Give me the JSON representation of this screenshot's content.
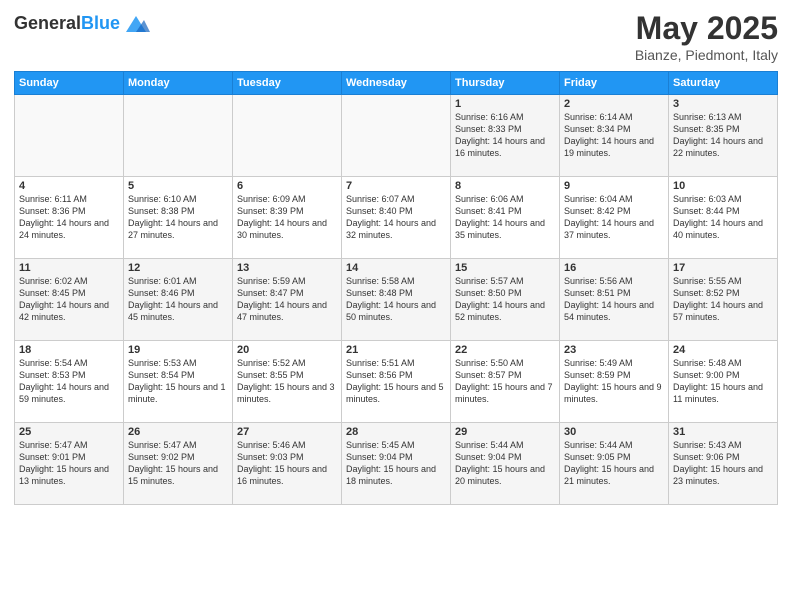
{
  "header": {
    "logo_general": "General",
    "logo_blue": "Blue",
    "month": "May 2025",
    "location": "Bianze, Piedmont, Italy"
  },
  "weekdays": [
    "Sunday",
    "Monday",
    "Tuesday",
    "Wednesday",
    "Thursday",
    "Friday",
    "Saturday"
  ],
  "weeks": [
    [
      {
        "day": "",
        "sunrise": "",
        "sunset": "",
        "daylight": ""
      },
      {
        "day": "",
        "sunrise": "",
        "sunset": "",
        "daylight": ""
      },
      {
        "day": "",
        "sunrise": "",
        "sunset": "",
        "daylight": ""
      },
      {
        "day": "",
        "sunrise": "",
        "sunset": "",
        "daylight": ""
      },
      {
        "day": "1",
        "sunrise": "Sunrise: 6:16 AM",
        "sunset": "Sunset: 8:33 PM",
        "daylight": "Daylight: 14 hours and 16 minutes."
      },
      {
        "day": "2",
        "sunrise": "Sunrise: 6:14 AM",
        "sunset": "Sunset: 8:34 PM",
        "daylight": "Daylight: 14 hours and 19 minutes."
      },
      {
        "day": "3",
        "sunrise": "Sunrise: 6:13 AM",
        "sunset": "Sunset: 8:35 PM",
        "daylight": "Daylight: 14 hours and 22 minutes."
      }
    ],
    [
      {
        "day": "4",
        "sunrise": "Sunrise: 6:11 AM",
        "sunset": "Sunset: 8:36 PM",
        "daylight": "Daylight: 14 hours and 24 minutes."
      },
      {
        "day": "5",
        "sunrise": "Sunrise: 6:10 AM",
        "sunset": "Sunset: 8:38 PM",
        "daylight": "Daylight: 14 hours and 27 minutes."
      },
      {
        "day": "6",
        "sunrise": "Sunrise: 6:09 AM",
        "sunset": "Sunset: 8:39 PM",
        "daylight": "Daylight: 14 hours and 30 minutes."
      },
      {
        "day": "7",
        "sunrise": "Sunrise: 6:07 AM",
        "sunset": "Sunset: 8:40 PM",
        "daylight": "Daylight: 14 hours and 32 minutes."
      },
      {
        "day": "8",
        "sunrise": "Sunrise: 6:06 AM",
        "sunset": "Sunset: 8:41 PM",
        "daylight": "Daylight: 14 hours and 35 minutes."
      },
      {
        "day": "9",
        "sunrise": "Sunrise: 6:04 AM",
        "sunset": "Sunset: 8:42 PM",
        "daylight": "Daylight: 14 hours and 37 minutes."
      },
      {
        "day": "10",
        "sunrise": "Sunrise: 6:03 AM",
        "sunset": "Sunset: 8:44 PM",
        "daylight": "Daylight: 14 hours and 40 minutes."
      }
    ],
    [
      {
        "day": "11",
        "sunrise": "Sunrise: 6:02 AM",
        "sunset": "Sunset: 8:45 PM",
        "daylight": "Daylight: 14 hours and 42 minutes."
      },
      {
        "day": "12",
        "sunrise": "Sunrise: 6:01 AM",
        "sunset": "Sunset: 8:46 PM",
        "daylight": "Daylight: 14 hours and 45 minutes."
      },
      {
        "day": "13",
        "sunrise": "Sunrise: 5:59 AM",
        "sunset": "Sunset: 8:47 PM",
        "daylight": "Daylight: 14 hours and 47 minutes."
      },
      {
        "day": "14",
        "sunrise": "Sunrise: 5:58 AM",
        "sunset": "Sunset: 8:48 PM",
        "daylight": "Daylight: 14 hours and 50 minutes."
      },
      {
        "day": "15",
        "sunrise": "Sunrise: 5:57 AM",
        "sunset": "Sunset: 8:50 PM",
        "daylight": "Daylight: 14 hours and 52 minutes."
      },
      {
        "day": "16",
        "sunrise": "Sunrise: 5:56 AM",
        "sunset": "Sunset: 8:51 PM",
        "daylight": "Daylight: 14 hours and 54 minutes."
      },
      {
        "day": "17",
        "sunrise": "Sunrise: 5:55 AM",
        "sunset": "Sunset: 8:52 PM",
        "daylight": "Daylight: 14 hours and 57 minutes."
      }
    ],
    [
      {
        "day": "18",
        "sunrise": "Sunrise: 5:54 AM",
        "sunset": "Sunset: 8:53 PM",
        "daylight": "Daylight: 14 hours and 59 minutes."
      },
      {
        "day": "19",
        "sunrise": "Sunrise: 5:53 AM",
        "sunset": "Sunset: 8:54 PM",
        "daylight": "Daylight: 15 hours and 1 minute."
      },
      {
        "day": "20",
        "sunrise": "Sunrise: 5:52 AM",
        "sunset": "Sunset: 8:55 PM",
        "daylight": "Daylight: 15 hours and 3 minutes."
      },
      {
        "day": "21",
        "sunrise": "Sunrise: 5:51 AM",
        "sunset": "Sunset: 8:56 PM",
        "daylight": "Daylight: 15 hours and 5 minutes."
      },
      {
        "day": "22",
        "sunrise": "Sunrise: 5:50 AM",
        "sunset": "Sunset: 8:57 PM",
        "daylight": "Daylight: 15 hours and 7 minutes."
      },
      {
        "day": "23",
        "sunrise": "Sunrise: 5:49 AM",
        "sunset": "Sunset: 8:59 PM",
        "daylight": "Daylight: 15 hours and 9 minutes."
      },
      {
        "day": "24",
        "sunrise": "Sunrise: 5:48 AM",
        "sunset": "Sunset: 9:00 PM",
        "daylight": "Daylight: 15 hours and 11 minutes."
      }
    ],
    [
      {
        "day": "25",
        "sunrise": "Sunrise: 5:47 AM",
        "sunset": "Sunset: 9:01 PM",
        "daylight": "Daylight: 15 hours and 13 minutes."
      },
      {
        "day": "26",
        "sunrise": "Sunrise: 5:47 AM",
        "sunset": "Sunset: 9:02 PM",
        "daylight": "Daylight: 15 hours and 15 minutes."
      },
      {
        "day": "27",
        "sunrise": "Sunrise: 5:46 AM",
        "sunset": "Sunset: 9:03 PM",
        "daylight": "Daylight: 15 hours and 16 minutes."
      },
      {
        "day": "28",
        "sunrise": "Sunrise: 5:45 AM",
        "sunset": "Sunset: 9:04 PM",
        "daylight": "Daylight: 15 hours and 18 minutes."
      },
      {
        "day": "29",
        "sunrise": "Sunrise: 5:44 AM",
        "sunset": "Sunset: 9:04 PM",
        "daylight": "Daylight: 15 hours and 20 minutes."
      },
      {
        "day": "30",
        "sunrise": "Sunrise: 5:44 AM",
        "sunset": "Sunset: 9:05 PM",
        "daylight": "Daylight: 15 hours and 21 minutes."
      },
      {
        "day": "31",
        "sunrise": "Sunrise: 5:43 AM",
        "sunset": "Sunset: 9:06 PM",
        "daylight": "Daylight: 15 hours and 23 minutes."
      }
    ]
  ]
}
